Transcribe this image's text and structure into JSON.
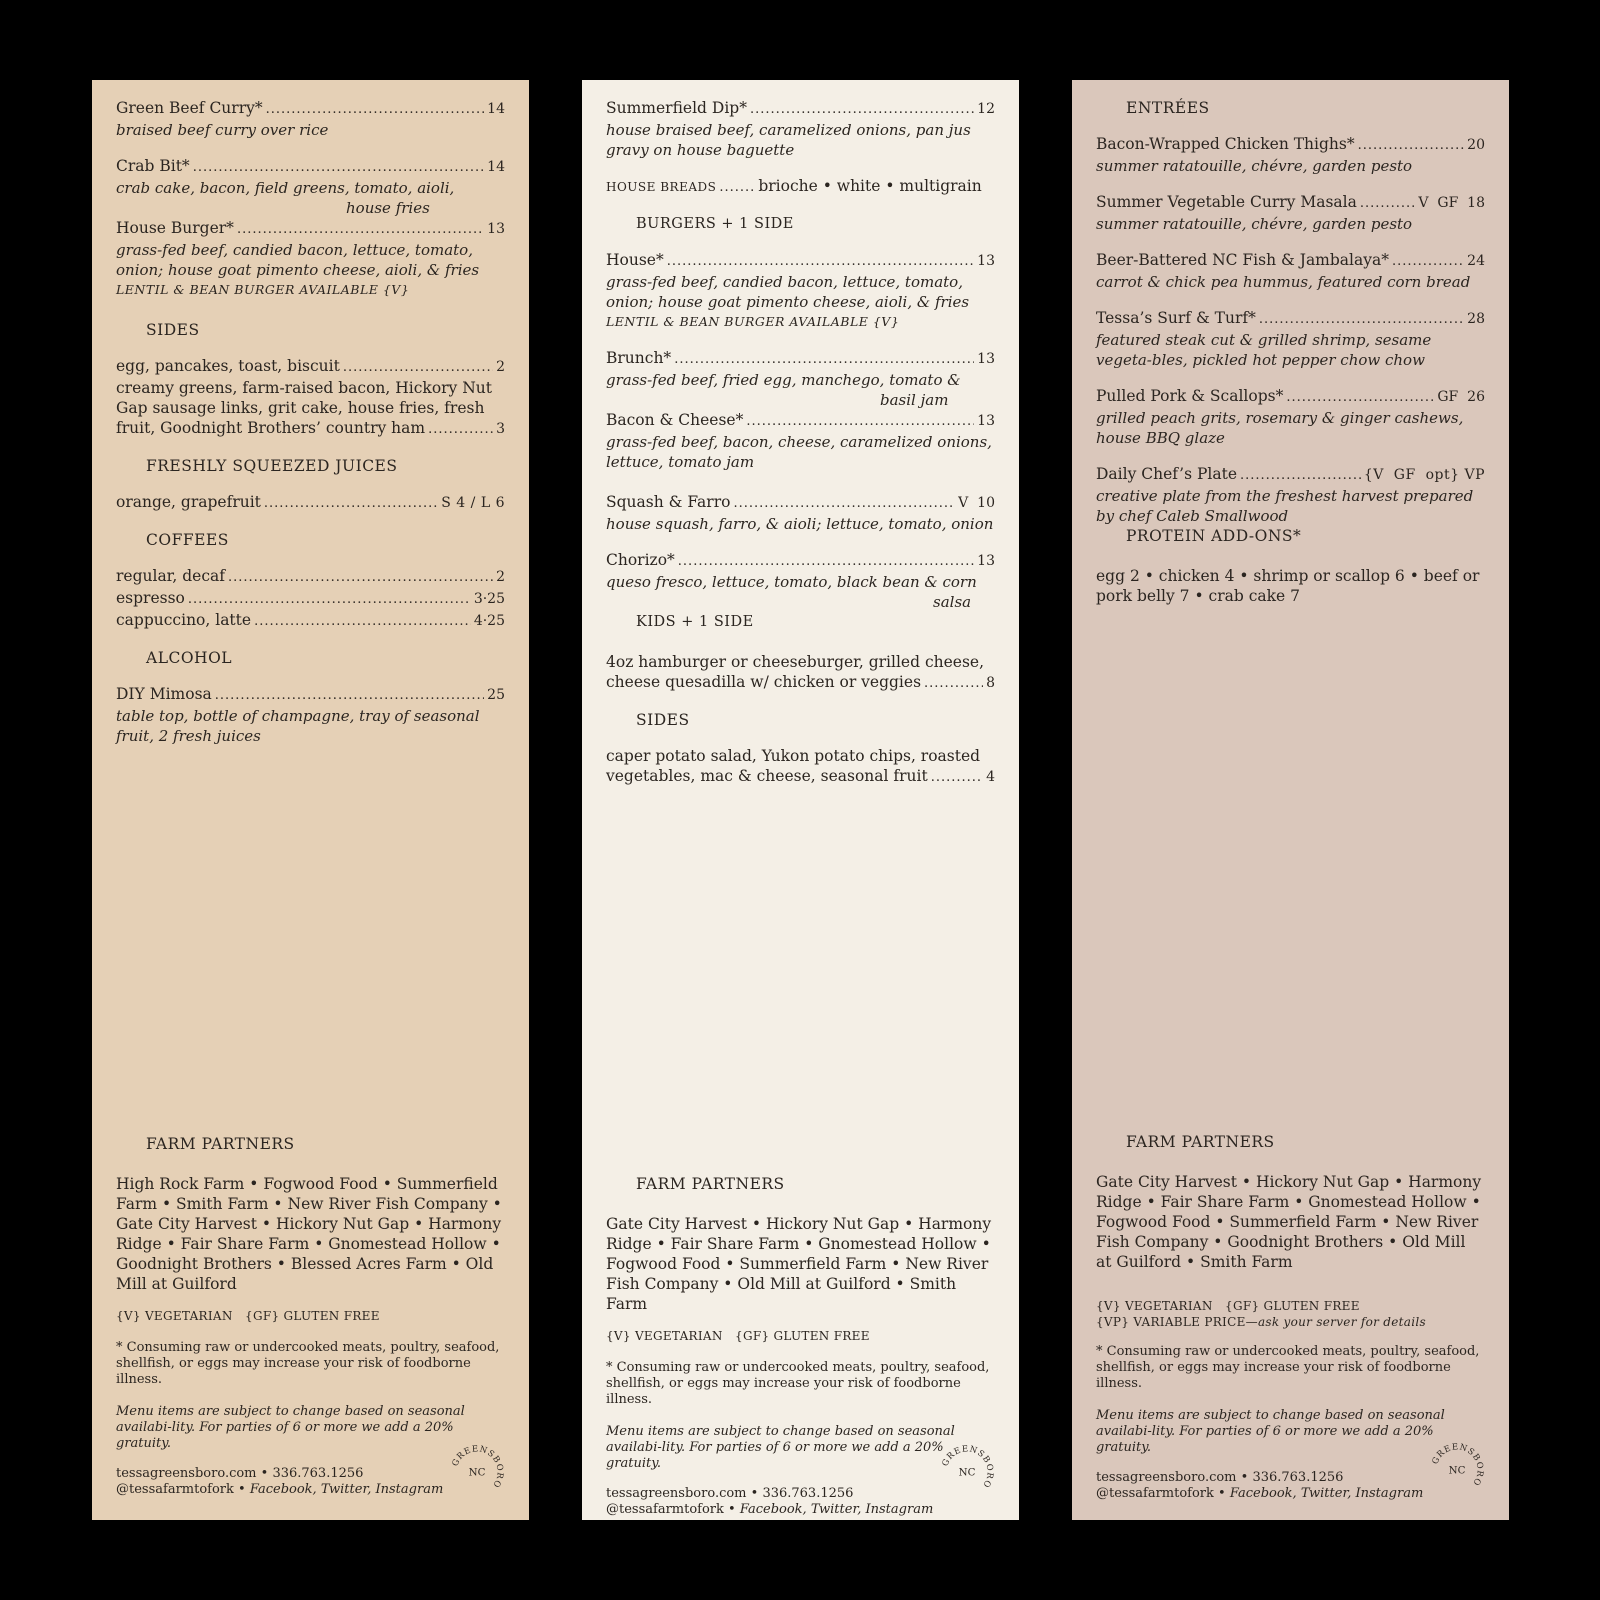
{
  "panel1": {
    "items": [
      {
        "name": "Green Beef Curry*",
        "price": "14",
        "desc": "braised beef curry over rice"
      },
      {
        "name": "Crab Bit*",
        "price": "14",
        "desc": "crab cake, bacon, field greens, tomato, aioli,",
        "desc2": "house fries"
      },
      {
        "name": "House Burger*",
        "price": "13",
        "desc": "grass-fed beef, candied bacon, lettuce, tomato, onion; house goat pimento cheese, aioli, & fries",
        "note": "LENTIL & BEAN BURGER AVAILABLE {V}"
      }
    ],
    "sides_head": "SIDES",
    "sides_row1": {
      "name": "egg, pancakes, toast, biscuit",
      "price": "2"
    },
    "sides_text": "creamy greens, farm-raised bacon, Hickory Nut Gap sausage links, grit cake, house fries, fresh",
    "sides_row2": {
      "name": "fruit, Goodnight Brothers’ country ham",
      "price": "3"
    },
    "juices_head": "FRESHLY SQUEEZED JUICES",
    "juices_row": {
      "name": "orange, grapefruit",
      "price": "S 4 / L 6"
    },
    "coffees_head": "COFFEES",
    "coffees": [
      {
        "name": "regular, decaf",
        "price": "2"
      },
      {
        "name": "espresso",
        "price": "3·25"
      },
      {
        "name": "cappuccino, latte",
        "price": "4·25"
      }
    ],
    "alcohol_head": "ALCOHOL",
    "alcohol_row": {
      "name": "DIY Mimosa",
      "price": "25",
      "desc": "table top, bottle of champagne, tray of seasonal fruit, 2 fresh juices"
    },
    "farm_head": "FARM PARTNERS",
    "farm_text": "High Rock Farm • Fogwood Food • Summerfield Farm • Smith Farm • New River Fish Company • Gate City Harvest • Hickory Nut Gap • Harmony Ridge • Fair Share Farm • Gnomestead Hollow • Goodnight Brothers • Blessed Acres Farm • Old Mill at Guilford",
    "legend": "{V} VEGETARIAN   {GF} GLUTEN FREE"
  },
  "panel2": {
    "summerfield": {
      "name": "Summerfield Dip*",
      "price": "12",
      "desc": "house braised beef, caramelized onions, pan jus gravy on house baguette"
    },
    "breads_label": "HOUSE BREADS",
    "breads_text": "brioche • white • multigrain",
    "burgers_head": "BURGERS + 1 SIDE",
    "items": [
      {
        "name": "House*",
        "price": "13",
        "desc": "grass-fed beef, candied bacon, lettuce, tomato, onion; house goat pimento cheese, aioli, & fries",
        "note": "LENTIL & BEAN BURGER AVAILABLE {V}"
      },
      {
        "name": "Brunch*",
        "price": "13",
        "desc": "grass-fed beef, fried egg, manchego, tomato &",
        "desc2": "basil jam"
      },
      {
        "name": "Bacon & Cheese*",
        "price": "13",
        "desc": "grass-fed beef, bacon, cheese, caramelized onions, lettuce, tomato jam"
      },
      {
        "name": "Squash & Farro",
        "price": "V  10",
        "desc": "house squash, farro, & aioli; lettuce, tomato, onion"
      },
      {
        "name": "Chorizo*",
        "price": "13",
        "desc": "queso fresco, lettuce, tomato, black bean & corn",
        "desc2": "salsa"
      }
    ],
    "kids_head": "KIDS + 1 SIDE",
    "kids_text": "4oz hamburger or cheeseburger, grilled cheese,",
    "kids_row": {
      "name": "cheese quesadilla w/ chicken or veggies",
      "price": "8"
    },
    "sides_head": "SIDES",
    "sides_text": "caper potato salad, Yukon potato chips, roasted",
    "sides_row": {
      "name": "vegetables, mac & cheese, seasonal fruit",
      "price": "4"
    },
    "farm_head": "FARM PARTNERS",
    "farm_text": "Gate City Harvest • Hickory Nut Gap • Harmony Ridge • Fair Share Farm • Gnomestead Hollow • Fogwood Food • Summerfield Farm • New River Fish Company • Old Mill at Guilford • Smith Farm",
    "legend": "{V} VEGETARIAN   {GF} GLUTEN FREE"
  },
  "panel3": {
    "entrees_head": "ENTRÉES",
    "items": [
      {
        "name": "Bacon-Wrapped Chicken Thighs*",
        "price": "20",
        "desc": "summer ratatouille, chévre, garden pesto"
      },
      {
        "name": "Summer Vegetable Curry Masala",
        "price": "V  GF  18",
        "desc": "summer ratatouille, chévre, garden pesto"
      },
      {
        "name": "Beer-Battered NC Fish & Jambalaya*",
        "price": "24",
        "desc": "carrot & chick pea hummus, featured corn bread"
      },
      {
        "name": "Tessa’s Surf & Turf*",
        "price": "28",
        "desc": "featured steak cut & grilled shrimp, sesame vegeta-bles, pickled hot pepper chow chow"
      },
      {
        "name": "Pulled Pork & Scallops*",
        "price": "GF  26",
        "desc": "grilled peach grits, rosemary & ginger cashews, house BBQ glaze"
      },
      {
        "name": "Daily Chef’s Plate",
        "price": "{V  GF  opt} VP",
        "desc": "creative plate from the freshest harvest prepared by chef Caleb Smallwood"
      }
    ],
    "addons_head": "PROTEIN ADD-ONS*",
    "addons_text": "egg 2 • chicken 4 • shrimp or scallop 6 • beef or pork belly 7 • crab cake 7",
    "farm_head": "FARM PARTNERS",
    "farm_text": "Gate City Harvest • Hickory Nut Gap • Harmony Ridge • Fair Share Farm • Gnomestead Hollow • Fogwood Food • Summerfield Farm • New River Fish Company • Goodnight Brothers • Old Mill at Guilford • Smith Farm",
    "legend": "{V} VEGETARIAN   {GF} GLUTEN FREE",
    "legend_vp_label": "{VP} VARIABLE PRICE—",
    "legend_vp_note": "ask your server for details"
  },
  "common": {
    "warning": "* Consuming raw or undercooked meats, poultry, seafood, shellfish, or eggs may increase your risk of foodborne illness.",
    "policy": "Menu items are subject to change based on seasonal availabi-lity. For parties of 6 or more we add a 20% gratuity.",
    "website": "tessagreensboro.com • 336.763.1256",
    "social_handle": "@tessafarmtofork",
    "social_sites": " • Facebook, Twitter, Instagram",
    "logo_ring": "GREENSBORO",
    "logo_center": "NC"
  }
}
